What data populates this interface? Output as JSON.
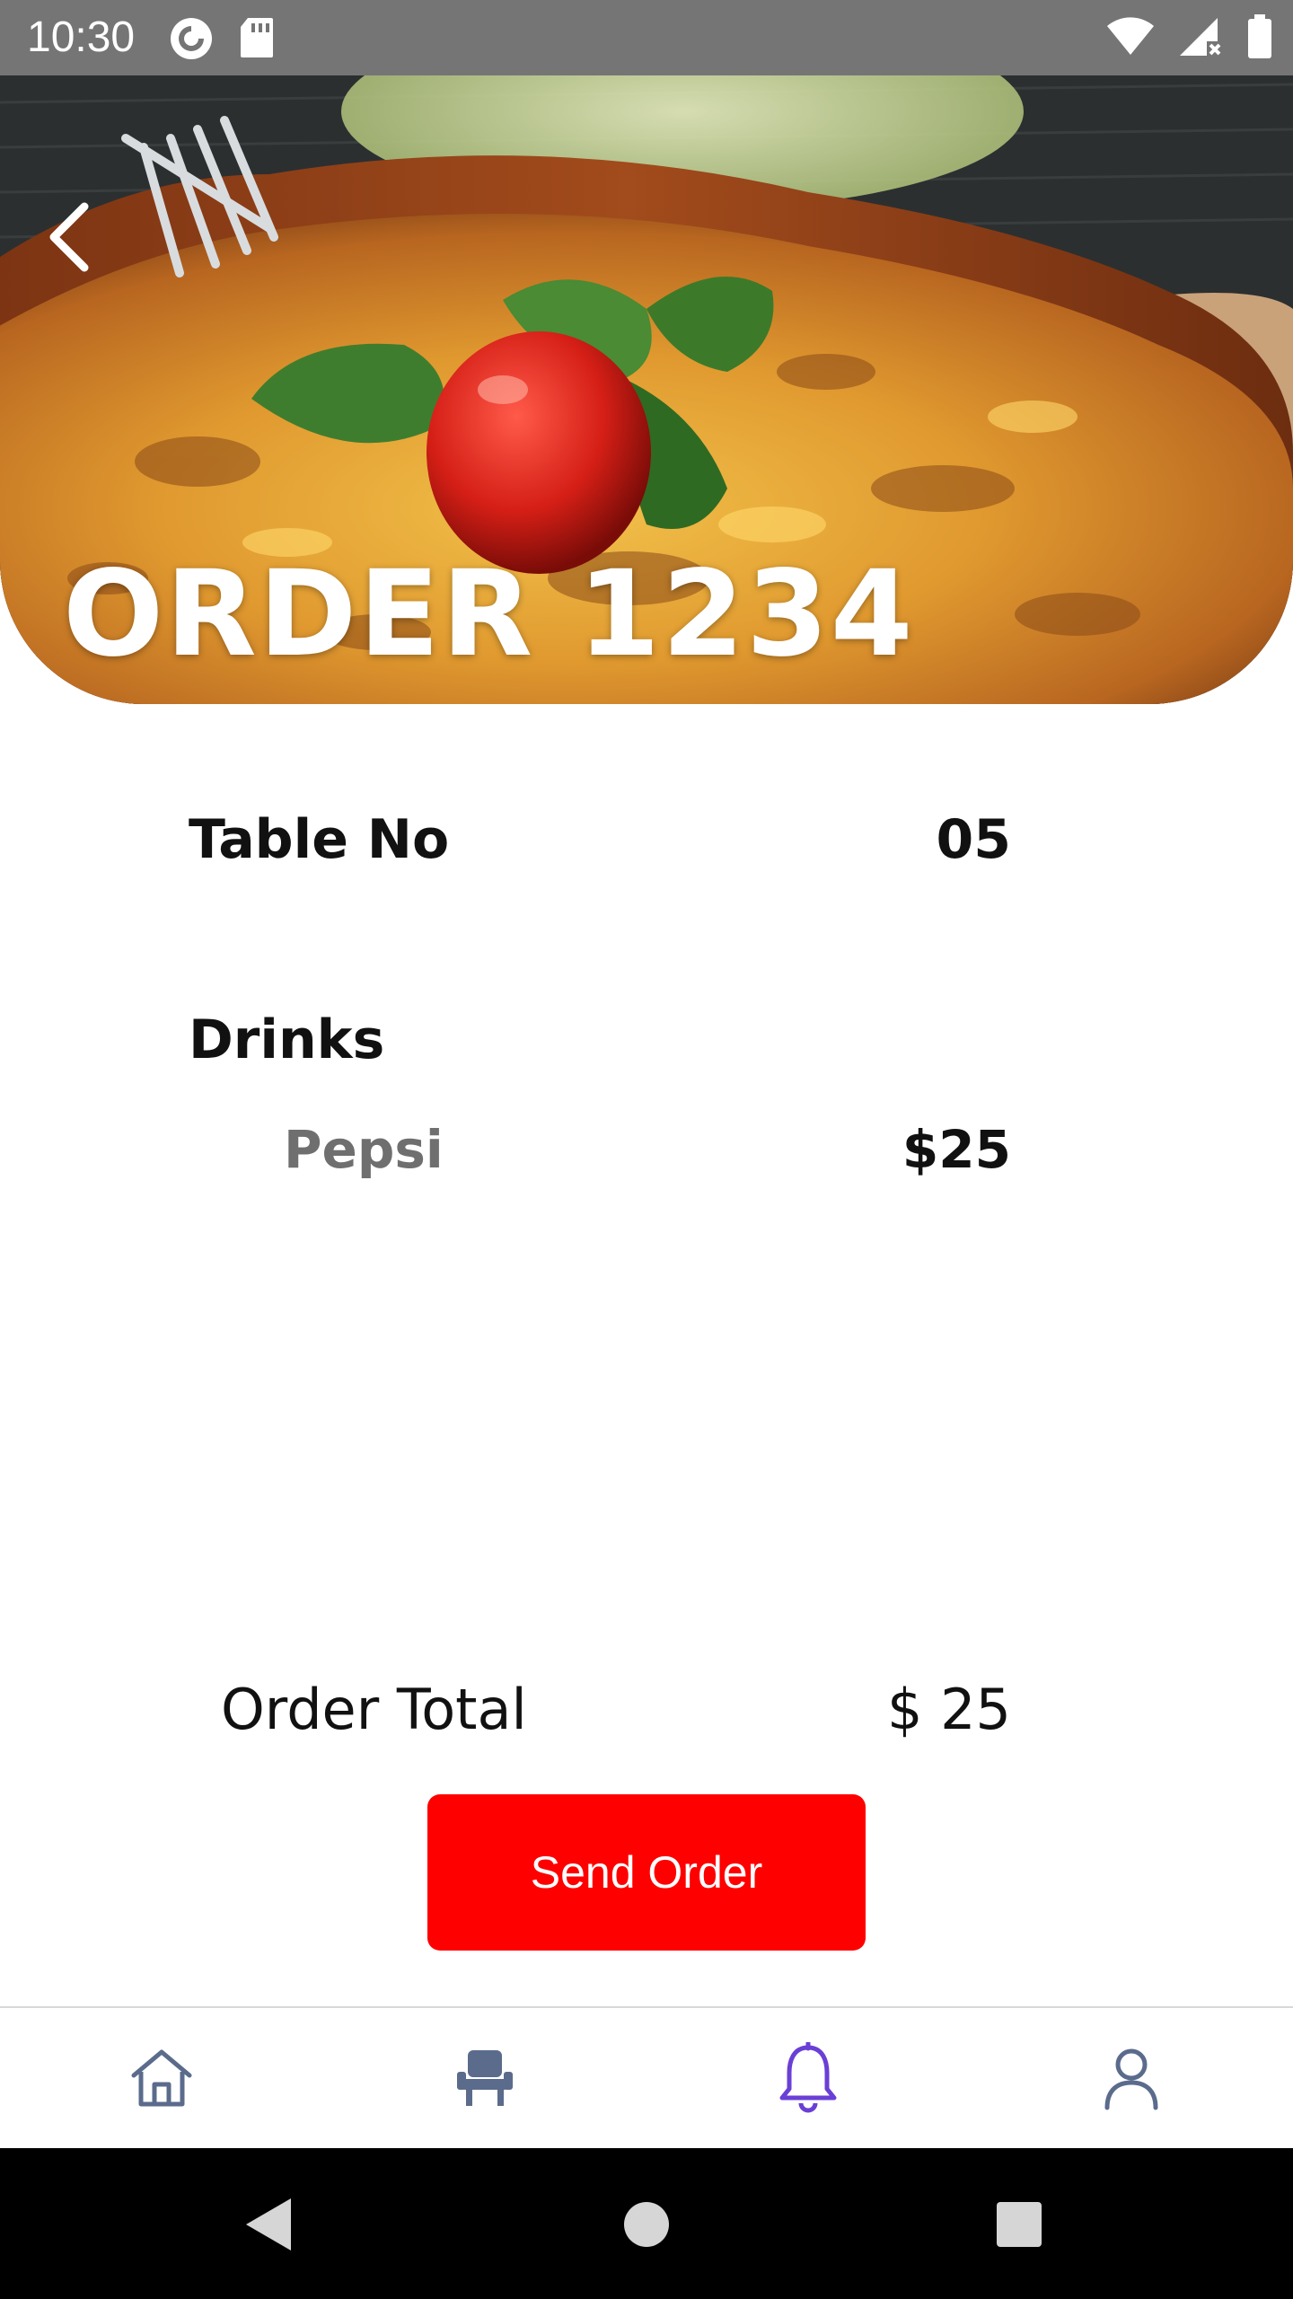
{
  "status_bar": {
    "time": "10:30",
    "left_icons": [
      "pocket-casts-icon",
      "sd-card-icon"
    ],
    "right_icons": [
      "wifi-icon",
      "cellular-no-data-icon",
      "battery-icon"
    ]
  },
  "hero": {
    "title": "ORDER 1234",
    "back_icon": "chevron-left-icon"
  },
  "order": {
    "table_label": "Table No",
    "table_value": "05",
    "section_title": "Drinks",
    "items": [
      {
        "name": "Pepsi",
        "price": "$25"
      }
    ],
    "total_label": "Order Total",
    "total_value": "$ 25",
    "send_label": "Send Order"
  },
  "bottom_nav": {
    "items": [
      {
        "icon": "home-icon",
        "active": false
      },
      {
        "icon": "seat-icon",
        "active": false
      },
      {
        "icon": "bell-icon",
        "active": true
      },
      {
        "icon": "user-icon",
        "active": false
      }
    ]
  },
  "colors": {
    "accent": "#ff0000",
    "nav_inactive": "#5b6b8c",
    "nav_active": "#6a3fd6",
    "status_bar": "#757575"
  }
}
